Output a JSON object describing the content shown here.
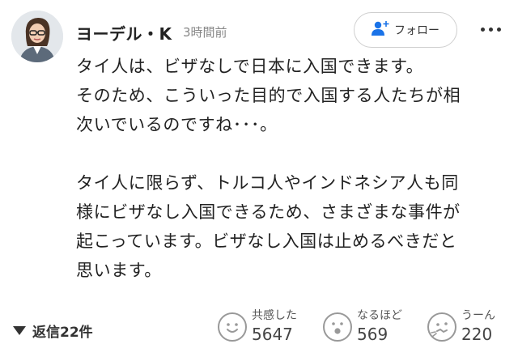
{
  "user": {
    "name": "ヨーデル・K",
    "time": "3時間前"
  },
  "follow": {
    "label": "フォロー"
  },
  "post": {
    "paragraphs": [
      [
        "タイ人は、ビザなしで日本に入国できます。",
        "そのため、こういった目的で入国する人たちが相",
        "次いでいるのですね･･･。"
      ],
      [
        "タイ人に限らず、トルコ人やインドネシア人も同",
        "様にビザなし入国できるため、さまざまな事件が",
        "起こっています。ビザなし入国は止めるべきだと",
        "思います。"
      ]
    ]
  },
  "replies": {
    "label": "返信22件"
  },
  "reactions": [
    {
      "label": "共感した",
      "count": "5647",
      "icon": "smile-face-icon"
    },
    {
      "label": "なるほど",
      "count": "569",
      "icon": "surprised-face-icon"
    },
    {
      "label": "うーん",
      "count": "220",
      "icon": "confused-face-icon"
    }
  ],
  "colors": {
    "text": "#222222",
    "muted": "#888888",
    "accent": "#1a73e8"
  }
}
